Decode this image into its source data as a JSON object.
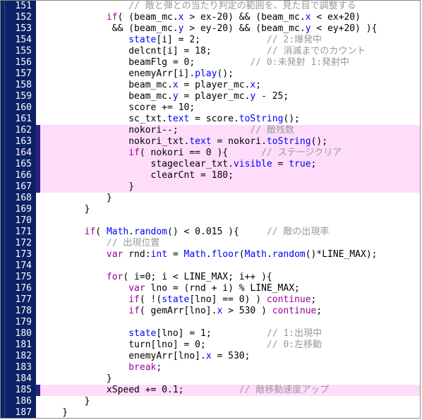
{
  "editor": {
    "name": "code-editor",
    "language": "ActionScript",
    "first_line": 151,
    "last_line": 187,
    "colors": {
      "gutter_bg": "#0d2265",
      "gutter_rule": "#2d4a8a",
      "lineno_fg": "#ffffff",
      "code_bg": "#ffffff",
      "highlight_bg": "#ffddfa",
      "highlight_strip": "#2e2383",
      "keyword": "#990099",
      "property": "#0000ff",
      "comment": "#999999",
      "plain": "#000000",
      "border": "#888888"
    }
  },
  "lines": [
    {
      "no": "151",
      "hl": false,
      "tokens": [
        {
          "t": "                ",
          "c": "pl"
        },
        {
          "t": "// 敵と弾との当たり判定の範囲を、見た目で調整する",
          "c": "cm"
        }
      ]
    },
    {
      "no": "152",
      "hl": false,
      "tokens": [
        {
          "t": "            ",
          "c": "pl"
        },
        {
          "t": "if",
          "c": "kw"
        },
        {
          "t": "( (beam_mc.",
          "c": "pl"
        },
        {
          "t": "x",
          "c": "prop"
        },
        {
          "t": " > ex-20) && (beam_mc.",
          "c": "pl"
        },
        {
          "t": "x",
          "c": "prop"
        },
        {
          "t": " < ex+20)",
          "c": "pl"
        }
      ]
    },
    {
      "no": "153",
      "hl": false,
      "tokens": [
        {
          "t": "             && (beam_mc.",
          "c": "pl"
        },
        {
          "t": "y",
          "c": "prop"
        },
        {
          "t": " > ey-20) && (beam_mc.",
          "c": "pl"
        },
        {
          "t": "y",
          "c": "prop"
        },
        {
          "t": " < ey+20) ){",
          "c": "pl"
        }
      ]
    },
    {
      "no": "154",
      "hl": false,
      "tokens": [
        {
          "t": "                ",
          "c": "pl"
        },
        {
          "t": "state",
          "c": "prop"
        },
        {
          "t": "[i] = 2;",
          "c": "pl"
        },
        {
          "t": "            ",
          "c": "pl"
        },
        {
          "t": "// 2:爆発中",
          "c": "cm"
        }
      ]
    },
    {
      "no": "155",
      "hl": false,
      "tokens": [
        {
          "t": "                delcnt[i] = 18;",
          "c": "pl"
        },
        {
          "t": "          ",
          "c": "pl"
        },
        {
          "t": "// 消滅までのカウント",
          "c": "cm"
        }
      ]
    },
    {
      "no": "156",
      "hl": false,
      "tokens": [
        {
          "t": "                beamFlg = 0;",
          "c": "pl"
        },
        {
          "t": "          ",
          "c": "pl"
        },
        {
          "t": "// 0:未発射 1:発射中",
          "c": "cm"
        }
      ]
    },
    {
      "no": "157",
      "hl": false,
      "tokens": [
        {
          "t": "                enemyArr[i].",
          "c": "pl"
        },
        {
          "t": "play",
          "c": "prop"
        },
        {
          "t": "();",
          "c": "pl"
        }
      ]
    },
    {
      "no": "158",
      "hl": false,
      "tokens": [
        {
          "t": "                beam_mc.",
          "c": "pl"
        },
        {
          "t": "x",
          "c": "prop"
        },
        {
          "t": " = player_mc.",
          "c": "pl"
        },
        {
          "t": "x",
          "c": "prop"
        },
        {
          "t": ";",
          "c": "pl"
        }
      ]
    },
    {
      "no": "159",
      "hl": false,
      "tokens": [
        {
          "t": "                beam_mc.",
          "c": "pl"
        },
        {
          "t": "y",
          "c": "prop"
        },
        {
          "t": " = player_mc.",
          "c": "pl"
        },
        {
          "t": "y",
          "c": "prop"
        },
        {
          "t": " - 25;",
          "c": "pl"
        }
      ]
    },
    {
      "no": "160",
      "hl": false,
      "tokens": [
        {
          "t": "                score += 10;",
          "c": "pl"
        }
      ]
    },
    {
      "no": "161",
      "hl": false,
      "tokens": [
        {
          "t": "                sc_txt.",
          "c": "pl"
        },
        {
          "t": "text",
          "c": "prop"
        },
        {
          "t": " = score.",
          "c": "pl"
        },
        {
          "t": "toString",
          "c": "prop"
        },
        {
          "t": "();",
          "c": "pl"
        }
      ]
    },
    {
      "no": "162",
      "hl": true,
      "tokens": [
        {
          "t": "                nokori--;",
          "c": "pl"
        },
        {
          "t": "             ",
          "c": "pl"
        },
        {
          "t": "// 敵残数",
          "c": "cm"
        }
      ]
    },
    {
      "no": "163",
      "hl": true,
      "tokens": [
        {
          "t": "                nokori_txt.",
          "c": "pl"
        },
        {
          "t": "text",
          "c": "prop"
        },
        {
          "t": " = nokori.",
          "c": "pl"
        },
        {
          "t": "toString",
          "c": "prop"
        },
        {
          "t": "();",
          "c": "pl"
        }
      ]
    },
    {
      "no": "164",
      "hl": true,
      "tokens": [
        {
          "t": "                ",
          "c": "pl"
        },
        {
          "t": "if",
          "c": "kw"
        },
        {
          "t": "( nokori == 0 ){",
          "c": "pl"
        },
        {
          "t": "      ",
          "c": "pl"
        },
        {
          "t": "// ステージクリア",
          "c": "cm"
        }
      ]
    },
    {
      "no": "165",
      "hl": true,
      "tokens": [
        {
          "t": "                    stageclear_txt.",
          "c": "pl"
        },
        {
          "t": "visible",
          "c": "prop"
        },
        {
          "t": " = ",
          "c": "pl"
        },
        {
          "t": "true",
          "c": "prop"
        },
        {
          "t": ";",
          "c": "pl"
        }
      ]
    },
    {
      "no": "166",
      "hl": true,
      "tokens": [
        {
          "t": "                    clearCnt = 180;",
          "c": "pl"
        }
      ]
    },
    {
      "no": "167",
      "hl": true,
      "tokens": [
        {
          "t": "                }",
          "c": "pl"
        }
      ]
    },
    {
      "no": "168",
      "hl": false,
      "tokens": [
        {
          "t": "            }",
          "c": "pl"
        }
      ]
    },
    {
      "no": "169",
      "hl": false,
      "tokens": [
        {
          "t": "        }",
          "c": "pl"
        }
      ]
    },
    {
      "no": "170",
      "hl": false,
      "tokens": [
        {
          "t": "",
          "c": "pl"
        }
      ]
    },
    {
      "no": "171",
      "hl": false,
      "tokens": [
        {
          "t": "        ",
          "c": "pl"
        },
        {
          "t": "if",
          "c": "kw"
        },
        {
          "t": "( ",
          "c": "pl"
        },
        {
          "t": "Math",
          "c": "prop"
        },
        {
          "t": ".",
          "c": "pl"
        },
        {
          "t": "random",
          "c": "prop"
        },
        {
          "t": "() < 0.015 ){",
          "c": "pl"
        },
        {
          "t": "     ",
          "c": "pl"
        },
        {
          "t": "// 敵の出現率",
          "c": "cm"
        }
      ]
    },
    {
      "no": "172",
      "hl": false,
      "tokens": [
        {
          "t": "            ",
          "c": "pl"
        },
        {
          "t": "// 出現位置",
          "c": "cm"
        }
      ]
    },
    {
      "no": "173",
      "hl": false,
      "tokens": [
        {
          "t": "            ",
          "c": "pl"
        },
        {
          "t": "var",
          "c": "kw"
        },
        {
          "t": " rnd:",
          "c": "pl"
        },
        {
          "t": "int",
          "c": "prop"
        },
        {
          "t": " = ",
          "c": "pl"
        },
        {
          "t": "Math",
          "c": "prop"
        },
        {
          "t": ".",
          "c": "pl"
        },
        {
          "t": "floor",
          "c": "prop"
        },
        {
          "t": "(",
          "c": "pl"
        },
        {
          "t": "Math",
          "c": "prop"
        },
        {
          "t": ".",
          "c": "pl"
        },
        {
          "t": "random",
          "c": "prop"
        },
        {
          "t": "()*LINE_MAX);",
          "c": "pl"
        }
      ]
    },
    {
      "no": "174",
      "hl": false,
      "tokens": [
        {
          "t": "",
          "c": "pl"
        }
      ]
    },
    {
      "no": "175",
      "hl": false,
      "tokens": [
        {
          "t": "            ",
          "c": "pl"
        },
        {
          "t": "for",
          "c": "kw"
        },
        {
          "t": "( i=0; i < LINE_MAX; i++ ){",
          "c": "pl"
        }
      ]
    },
    {
      "no": "176",
      "hl": false,
      "tokens": [
        {
          "t": "                ",
          "c": "pl"
        },
        {
          "t": "var",
          "c": "kw"
        },
        {
          "t": " lno = (rnd + i) % LINE_MAX;",
          "c": "pl"
        }
      ]
    },
    {
      "no": "177",
      "hl": false,
      "tokens": [
        {
          "t": "                ",
          "c": "pl"
        },
        {
          "t": "if",
          "c": "kw"
        },
        {
          "t": "( !(",
          "c": "pl"
        },
        {
          "t": "state",
          "c": "prop"
        },
        {
          "t": "[lno] == 0) ) ",
          "c": "pl"
        },
        {
          "t": "continue",
          "c": "kw"
        },
        {
          "t": ";",
          "c": "pl"
        }
      ]
    },
    {
      "no": "178",
      "hl": false,
      "tokens": [
        {
          "t": "                ",
          "c": "pl"
        },
        {
          "t": "if",
          "c": "kw"
        },
        {
          "t": "( gemArr[lno].",
          "c": "pl"
        },
        {
          "t": "x",
          "c": "prop"
        },
        {
          "t": " > 530 ) ",
          "c": "pl"
        },
        {
          "t": "continue",
          "c": "kw"
        },
        {
          "t": ";",
          "c": "pl"
        }
      ]
    },
    {
      "no": "179",
      "hl": false,
      "tokens": [
        {
          "t": "",
          "c": "pl"
        }
      ]
    },
    {
      "no": "180",
      "hl": false,
      "tokens": [
        {
          "t": "                ",
          "c": "pl"
        },
        {
          "t": "state",
          "c": "prop"
        },
        {
          "t": "[lno] = 1;",
          "c": "pl"
        },
        {
          "t": "          ",
          "c": "pl"
        },
        {
          "t": "// 1:出現中",
          "c": "cm"
        }
      ]
    },
    {
      "no": "181",
      "hl": false,
      "tokens": [
        {
          "t": "                turn[lno] = 0;",
          "c": "pl"
        },
        {
          "t": "           ",
          "c": "pl"
        },
        {
          "t": "// 0:左移動",
          "c": "cm"
        }
      ]
    },
    {
      "no": "182",
      "hl": false,
      "tokens": [
        {
          "t": "                enemyArr[lno].",
          "c": "pl"
        },
        {
          "t": "x",
          "c": "prop"
        },
        {
          "t": " = 530;",
          "c": "pl"
        }
      ]
    },
    {
      "no": "183",
      "hl": false,
      "tokens": [
        {
          "t": "                ",
          "c": "pl"
        },
        {
          "t": "break",
          "c": "kw"
        },
        {
          "t": ";",
          "c": "pl"
        }
      ]
    },
    {
      "no": "184",
      "hl": false,
      "tokens": [
        {
          "t": "            }",
          "c": "pl"
        }
      ]
    },
    {
      "no": "185",
      "hl": true,
      "tokens": [
        {
          "t": "            xSpeed += 0.1;",
          "c": "pl"
        },
        {
          "t": "          ",
          "c": "pl"
        },
        {
          "t": "// 敵移動速度アップ",
          "c": "cm"
        }
      ]
    },
    {
      "no": "186",
      "hl": false,
      "tokens": [
        {
          "t": "        }",
          "c": "pl"
        }
      ]
    },
    {
      "no": "187",
      "hl": false,
      "tokens": [
        {
          "t": "    }",
          "c": "pl"
        }
      ]
    }
  ]
}
